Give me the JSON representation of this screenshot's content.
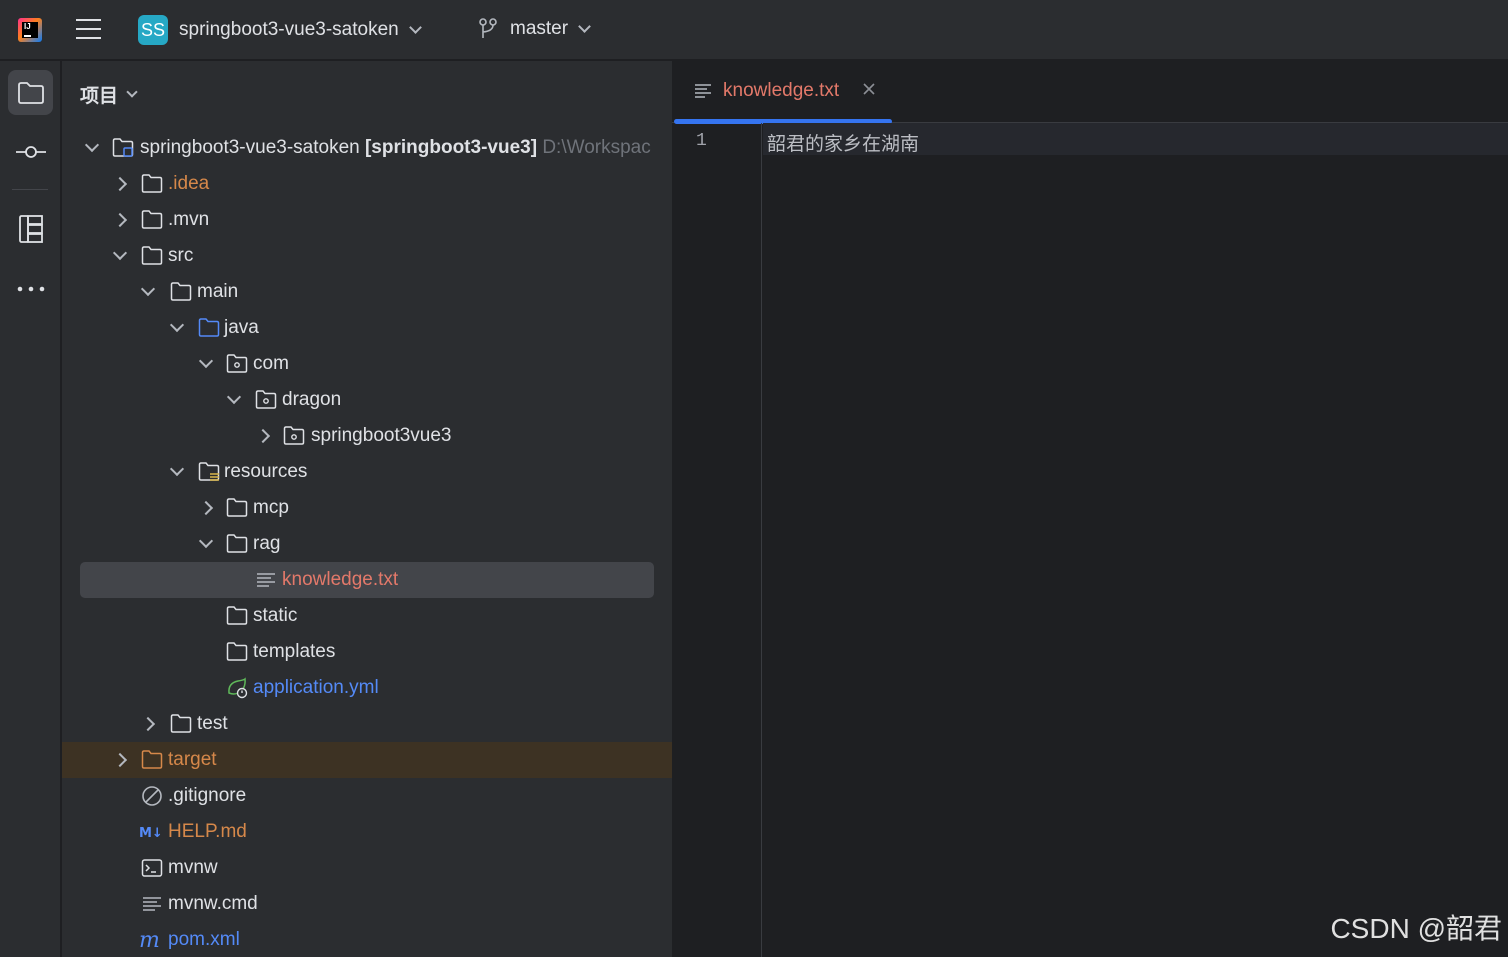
{
  "titlebar": {
    "project_badge": "SS",
    "project_name": "springboot3-vue3-satoken",
    "branch": "master"
  },
  "leftbar": {
    "items": [
      "folder-icon",
      "commit-icon",
      "structure-icon",
      "more-icon"
    ]
  },
  "project_panel": {
    "title": "项目",
    "root": {
      "name": "springboot3-vue3-satoken",
      "module": "[springboot3-vue3]",
      "path": "D:\\Workspac"
    },
    "items": [
      {
        "label": ".idea",
        "color": "#d6884a"
      },
      {
        "label": ".mvn"
      },
      {
        "label": "src"
      },
      {
        "label": "main"
      },
      {
        "label": "java"
      },
      {
        "label": "com"
      },
      {
        "label": "dragon"
      },
      {
        "label": "springboot3vue3"
      },
      {
        "label": "resources"
      },
      {
        "label": "mcp"
      },
      {
        "label": "rag"
      },
      {
        "label": "knowledge.txt",
        "color": "#e3796a"
      },
      {
        "label": "static"
      },
      {
        "label": "templates"
      },
      {
        "label": "application.yml",
        "color": "#548af7"
      },
      {
        "label": "test"
      },
      {
        "label": "target",
        "color": "#d6884a"
      },
      {
        "label": ".gitignore"
      },
      {
        "label": "HELP.md",
        "color": "#d6884a"
      },
      {
        "label": "mvnw"
      },
      {
        "label": "mvnw.cmd"
      },
      {
        "label": "pom.xml",
        "color": "#548af7"
      }
    ]
  },
  "editor": {
    "tab_label": "knowledge.txt",
    "line_number": "1",
    "line_text": "韶君的家乡在湖南"
  },
  "watermark": "CSDN @韶君",
  "colors": {
    "accent": "#3574f0",
    "modified_file": "#e3796a",
    "excluded": "#d6884a",
    "link_blue": "#548af7"
  }
}
